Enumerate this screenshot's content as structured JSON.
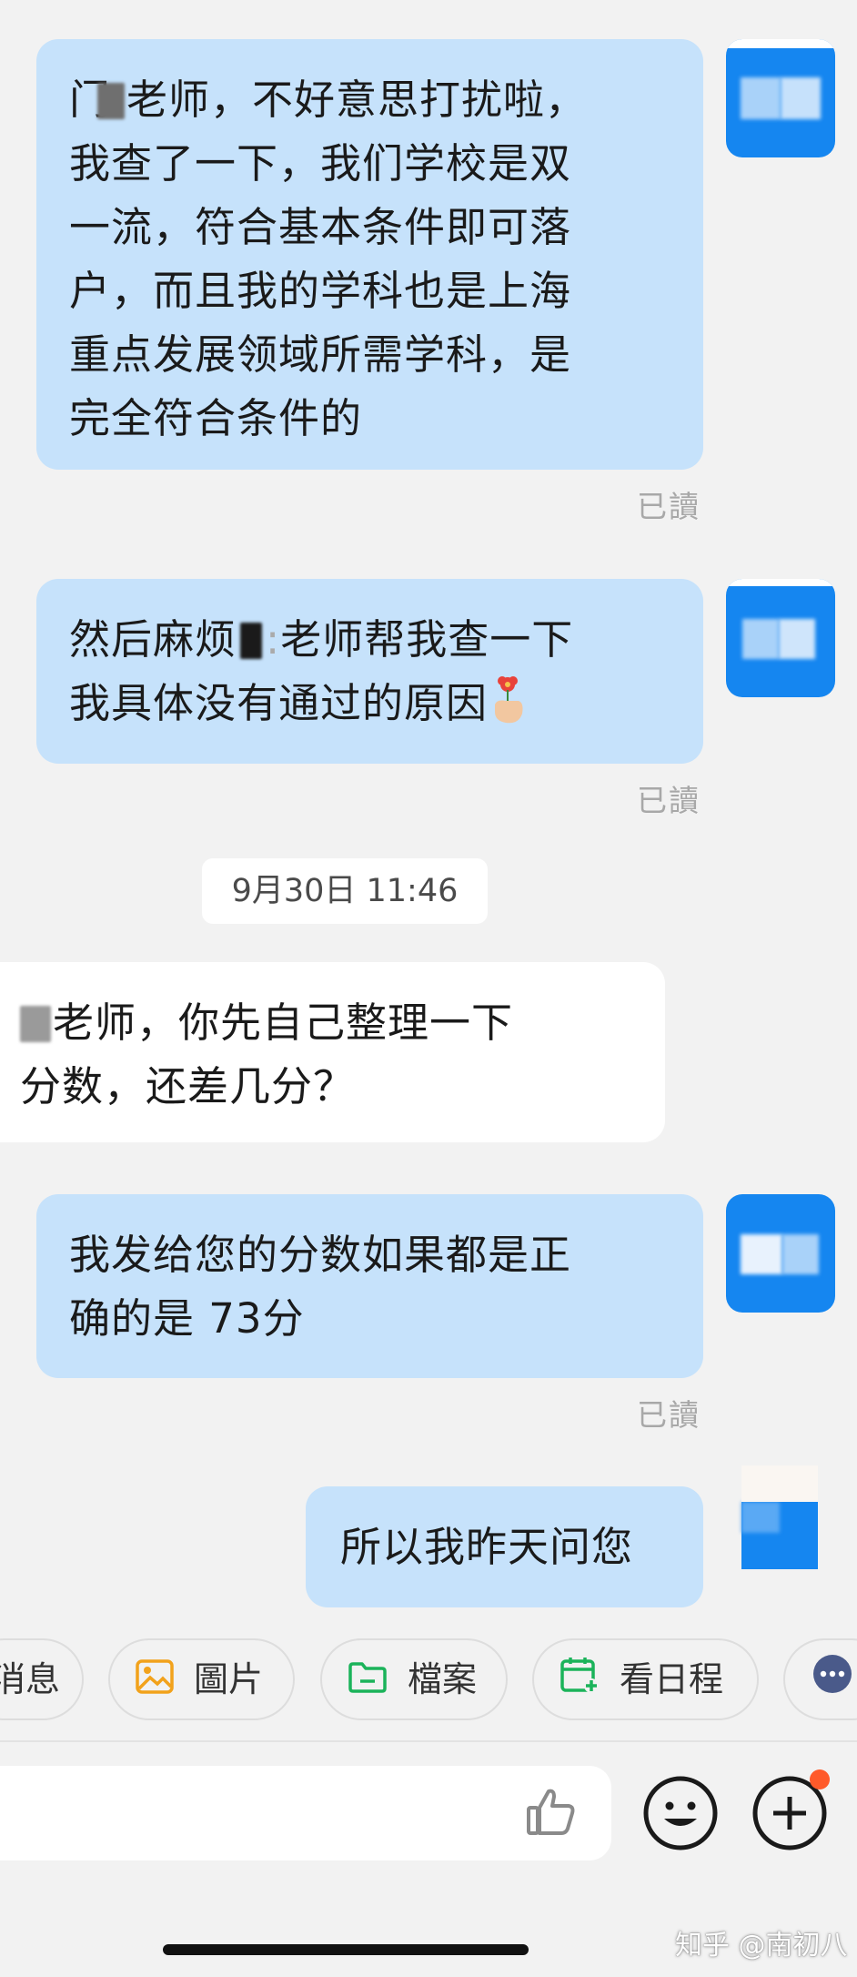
{
  "messages": [
    {
      "lines": [
        "老师，不好意思打扰啦，",
        "我查了一下，我们学校是双",
        "一流，符合基本条件即可落",
        "户，而且我的学科也是上海",
        "重点发展领域所需学科，是",
        "完全符合条件的"
      ],
      "prefix": "门",
      "status": "已讀"
    },
    {
      "lines": [
        "然后麻烦",
        "老师帮我查一下",
        "我具体没有通过的原因"
      ],
      "status": "已讀"
    },
    {
      "timestamp": "9月30日 11:46"
    },
    {
      "lines": [
        "老师，你先自己整理一下",
        "分数，还差几分？"
      ]
    },
    {
      "lines": [
        "我发给您的分数如果都是正",
        "确的是 73分"
      ],
      "status": "已讀"
    },
    {
      "lines": [
        "所以我昨天问您"
      ]
    }
  ],
  "quick_actions": [
    {
      "label": "消息",
      "icon": "message-icon"
    },
    {
      "label": "圖片",
      "icon": "image-icon",
      "color": "#f2a21b"
    },
    {
      "label": "檔案",
      "icon": "folder-icon",
      "color": "#1bb35a"
    },
    {
      "label": "看日程",
      "icon": "calendar-add-icon",
      "color": "#1bb35a"
    },
    {
      "label": "",
      "icon": "more-icon",
      "color": "#4a5a8a"
    }
  ],
  "composer": {
    "like_icon": "thumbs-up-icon",
    "emoji_icon": "smiley-icon",
    "plus_icon": "plus-circle-icon",
    "badge_color": "#ff5a2a"
  },
  "watermark": "知乎 @南初八",
  "colors": {
    "outgoing_bubble": "#c6e2fb",
    "incoming_bubble": "#ffffff",
    "avatar": "#1586f0",
    "background": "#f2f2f2"
  }
}
